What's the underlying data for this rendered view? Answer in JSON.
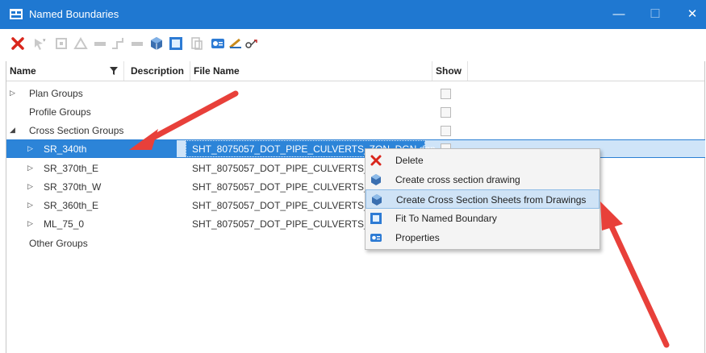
{
  "window": {
    "title": "Named Boundaries",
    "minimize": "—",
    "maximize": "☐",
    "close": "✕"
  },
  "toolbar": {
    "tools": [
      "delete-icon",
      "tool-icon-2",
      "tool-icon-3",
      "tool-icon-4",
      "tool-icon-5",
      "tool-icon-6",
      "tool-icon-7",
      "cube-icon",
      "fit-icon",
      "tool-icon-10",
      "properties-icon",
      "pencil-icon",
      "link-icon"
    ]
  },
  "columns": {
    "name": "Name",
    "description": "Description",
    "file_name": "File Name",
    "show": "Show"
  },
  "rows": [
    {
      "label": "Plan Groups",
      "expander": "▷",
      "file": "",
      "show_checkbox": true
    },
    {
      "label": "Profile Groups",
      "expander": "",
      "file": "",
      "show_checkbox": true
    },
    {
      "label": "Cross Section Groups",
      "expander": "◢",
      "file": "",
      "show_checkbox": true
    },
    {
      "label": "SR_340th",
      "expander": "▷",
      "file": "SHT_8075057_DOT_PIPE_CULVERTS_ZON_DGN.dgn",
      "show_checkbox": true,
      "selected": true
    },
    {
      "label": "SR_370th_E",
      "expander": "▷",
      "file": "SHT_8075057_DOT_PIPE_CULVERTS_ZO",
      "show_checkbox": false
    },
    {
      "label": "SR_370th_W",
      "expander": "▷",
      "file": "SHT_8075057_DOT_PIPE_CULVERTS_ZO",
      "show_checkbox": false
    },
    {
      "label": "SR_360th_E",
      "expander": "▷",
      "file": "SHT_8075057_DOT_PIPE_CULVERTS_ZO",
      "show_checkbox": false
    },
    {
      "label": "ML_75_0",
      "expander": "▷",
      "file": "SHT_8075057_DOT_PIPE_CULVERTS_ZO",
      "show_checkbox": false
    },
    {
      "label": "Other Groups",
      "expander": "",
      "file": "",
      "show_checkbox": false
    }
  ],
  "context_menu": {
    "items": [
      {
        "label": "Delete",
        "icon": "delete-icon"
      },
      {
        "label": "Create cross section drawing",
        "icon": "cube-icon"
      },
      {
        "label": "Create Cross Section Sheets from Drawings",
        "icon": "cube-icon",
        "hovered": true
      },
      {
        "label": "Fit To Named Boundary",
        "icon": "fit-icon"
      },
      {
        "label": "Properties",
        "icon": "properties-icon"
      }
    ]
  },
  "colors": {
    "titlebar": "#1f78d1",
    "selection": "#2c84d8",
    "annotation_arrow": "#e8403a"
  }
}
